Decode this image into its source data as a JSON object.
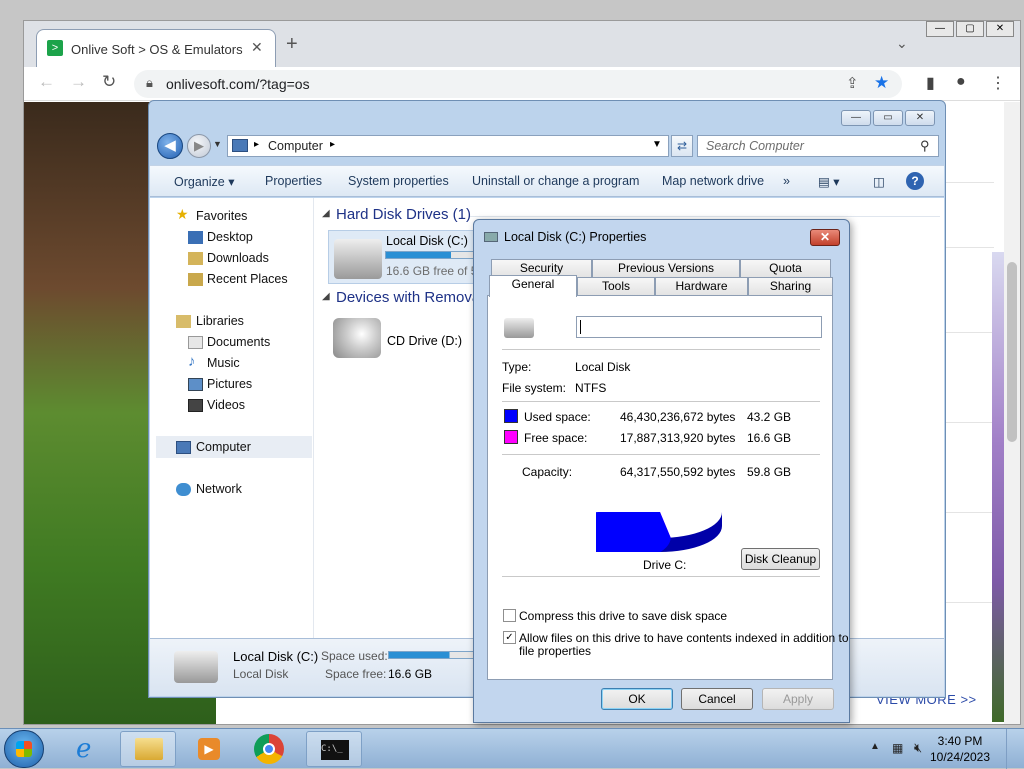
{
  "browser": {
    "tab_title": "Onlive Soft > OS & Emulators",
    "favicon_glyph": ">",
    "new_tab": "+",
    "tab_close": "✕",
    "url": "onlivesoft.com/?tag=os",
    "page_link": "VIEW MORE >>"
  },
  "explorer": {
    "address": "Computer",
    "search_placeholder": "Search Computer",
    "commands": [
      "Organize ▾",
      "Properties",
      "System properties",
      "Uninstall or change a program",
      "Map network drive",
      "»"
    ],
    "nav": {
      "favorites": "Favorites",
      "desktop": "Desktop",
      "downloads": "Downloads",
      "recent": "Recent Places",
      "libraries": "Libraries",
      "documents": "Documents",
      "music": "Music",
      "pictures": "Pictures",
      "videos": "Videos",
      "computer": "Computer",
      "network": "Network"
    },
    "hdd_group": "Hard Disk Drives (1)",
    "removable_group": "Devices with Remova",
    "drive_c_name": "Local Disk (C:)",
    "drive_c_free": "16.6 GB free of 5",
    "drive_c_used_fraction": 0.72,
    "cd_name": "CD Drive (D:)",
    "details": {
      "name": "Local Disk (C:)",
      "type": "Local Disk",
      "used_label": "Space used:",
      "free_label": "Space free:",
      "free_value": "16.6 GB"
    }
  },
  "dialog": {
    "title": "Local Disk (C:) Properties",
    "close": "✕",
    "tabs_top": [
      "Security",
      "Previous Versions",
      "Quota"
    ],
    "tabs_bottom": [
      "General",
      "Tools",
      "Hardware",
      "Sharing"
    ],
    "label_value": "",
    "type_label": "Type:",
    "type_value": "Local Disk",
    "fs_label": "File system:",
    "fs_value": "NTFS",
    "used_label": "Used space:",
    "used_bytes": "46,430,236,672 bytes",
    "used_gb": "43.2 GB",
    "used_color": "#0000ff",
    "free_label": "Free space:",
    "free_bytes": "17,887,313,920 bytes",
    "free_gb": "16.6 GB",
    "free_color": "#ff00ff",
    "capacity_label": "Capacity:",
    "capacity_bytes": "64,317,550,592 bytes",
    "capacity_gb": "59.8 GB",
    "drive_label": "Drive C:",
    "cleanup_button": "Disk Cleanup",
    "compress_label": "Compress this drive to save disk space",
    "compress_checked": false,
    "index_label": "Allow files on this drive to have contents indexed in addition to",
    "index_label_2": "file properties",
    "index_checked": true,
    "ok": "OK",
    "cancel": "Cancel",
    "apply": "Apply"
  },
  "taskbar": {
    "time": "3:40 PM",
    "date": "10/24/2023",
    "tray_arrow": "▲"
  }
}
